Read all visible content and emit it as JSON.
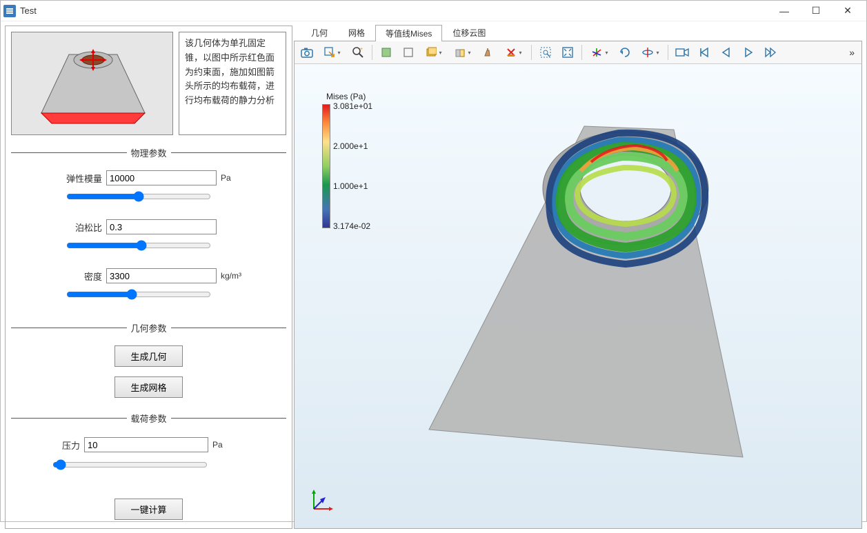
{
  "window": {
    "title": "Test"
  },
  "win_controls": {
    "min": "—",
    "max": "☐",
    "close": "✕"
  },
  "info_text": "该几何体为单孔固定锥，以图中所示红色面为约束面，施加如图箭头所示的均布载荷，进行均布载荷的静力分析",
  "sections": {
    "physical": "物理参数",
    "geometry": "几何参数",
    "load": "载荷参数"
  },
  "physical": {
    "elastic_label": "弹性模量",
    "elastic_value": "10000",
    "elastic_unit": "Pa",
    "poisson_label": "泊松比",
    "poisson_value": "0.3",
    "density_label": "密度",
    "density_value": "3300",
    "density_unit": "kg/m³"
  },
  "geometry": {
    "gen_geometry": "生成几何",
    "gen_mesh": "生成网格"
  },
  "load": {
    "pressure_label": "压力",
    "pressure_value": "10",
    "pressure_unit": "Pa"
  },
  "compute_btn": "一键计算",
  "tabs": {
    "geometry": "几何",
    "mesh": "网格",
    "contour": "等值线Mises",
    "displacement": "位移云图"
  },
  "legend": {
    "title": "Mises (Pa)",
    "t0": "3.081e+01",
    "t1": "2.000e+1",
    "t2": "1.000e+1",
    "t3": "3.174e-02"
  },
  "more": "»",
  "icons": {
    "camera": "camera",
    "export": "export",
    "zoom": "zoom",
    "sel_obj": "select-obj",
    "sel_dom": "select-dom",
    "sel_bnd": "select-bnd",
    "vis": "visibility",
    "ruler": "measure",
    "del": "delete",
    "zoom_sel": "zoom-sel",
    "zoom_ext": "zoom-ext",
    "axes": "axes-orient",
    "rot": "rotate",
    "rot_axis": "rotate-axis",
    "cam_on": "camera-on",
    "prev_frame": "prev-frame",
    "play_back": "play-back",
    "play": "play",
    "next": "next-frame"
  }
}
